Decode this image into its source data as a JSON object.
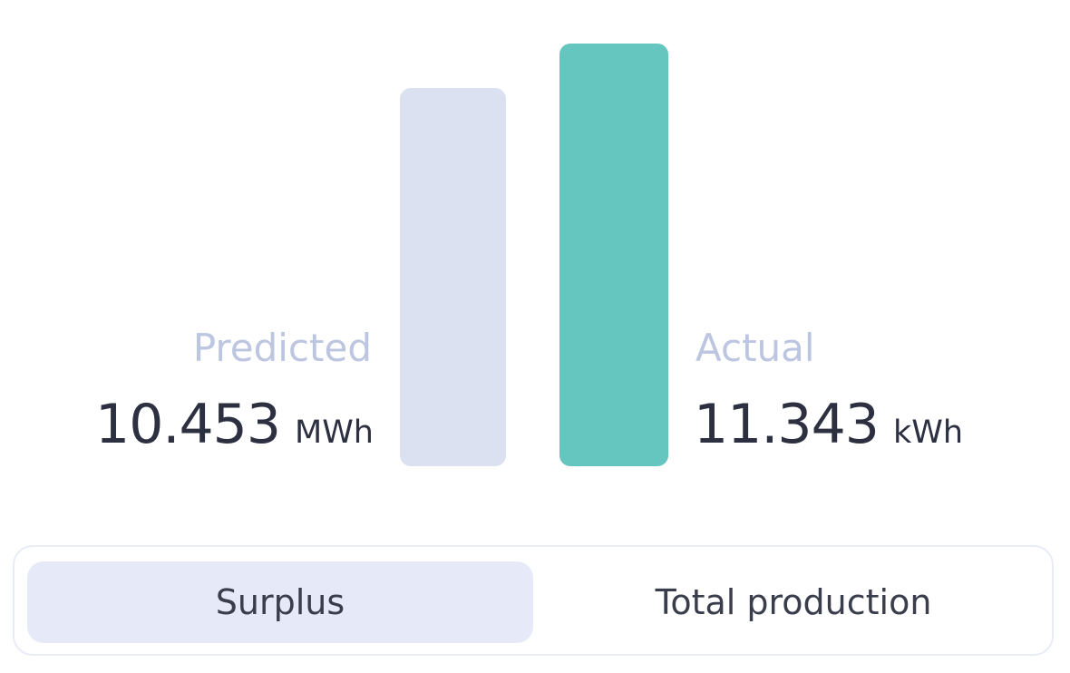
{
  "colors": {
    "predicted_bar": "#dce1f2",
    "actual_bar": "#65c6c0",
    "label_text": "#bcc6e0",
    "value_text": "#2c3040"
  },
  "predicted": {
    "label": "Predicted",
    "value": "10.453",
    "unit": "MWh"
  },
  "actual": {
    "label": "Actual",
    "value": "11.343",
    "unit": "kWh"
  },
  "toggle": {
    "options": [
      {
        "label": "Surplus",
        "selected": true
      },
      {
        "label": "Total production",
        "selected": false
      }
    ]
  }
}
